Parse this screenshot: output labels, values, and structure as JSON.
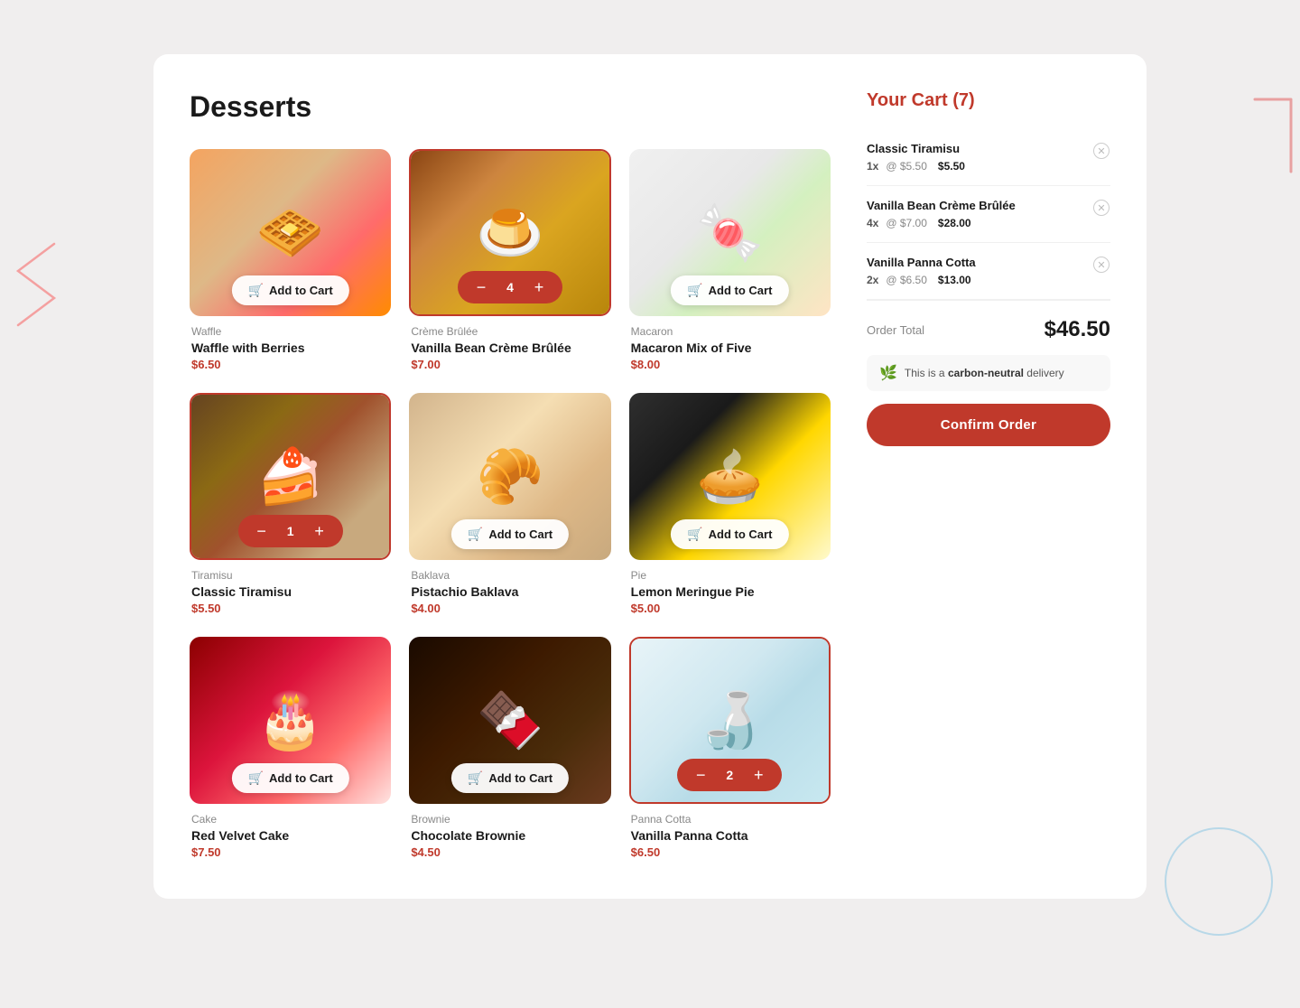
{
  "page": {
    "title": "Desserts",
    "background_color": "#f0eeee"
  },
  "products": [
    {
      "id": "waffle",
      "category": "Waffle",
      "name": "Waffle with Berries",
      "price": "$6.50",
      "image_class": "img-waffle",
      "emoji": "🧇",
      "has_quantity": false,
      "quantity": 0
    },
    {
      "id": "creme-brulee",
      "category": "Crème Brûlée",
      "name": "Vanilla Bean Crème Brûlée",
      "price": "$7.00",
      "image_class": "img-creme",
      "emoji": "🍮",
      "has_quantity": true,
      "quantity": 4,
      "selected": true
    },
    {
      "id": "macaron",
      "category": "Macaron",
      "name": "Macaron Mix of Five",
      "price": "$8.00",
      "image_class": "img-macaron",
      "emoji": "🍬",
      "has_quantity": false,
      "quantity": 0
    },
    {
      "id": "tiramisu",
      "category": "Tiramisu",
      "name": "Classic Tiramisu",
      "price": "$5.50",
      "image_class": "img-tiramisu",
      "emoji": "🍰",
      "has_quantity": true,
      "quantity": 1,
      "selected": true
    },
    {
      "id": "baklava",
      "category": "Baklava",
      "name": "Pistachio Baklava",
      "price": "$4.00",
      "image_class": "img-baklava",
      "emoji": "🥐",
      "has_quantity": false,
      "quantity": 0
    },
    {
      "id": "lemon-pie",
      "category": "Pie",
      "name": "Lemon Meringue Pie",
      "price": "$5.00",
      "image_class": "img-lemon-pie",
      "emoji": "🥧",
      "has_quantity": false,
      "quantity": 0
    },
    {
      "id": "red-velvet",
      "category": "Cake",
      "name": "Red Velvet Cake",
      "price": "$7.50",
      "image_class": "img-redvelvet",
      "emoji": "🎂",
      "has_quantity": false,
      "quantity": 0
    },
    {
      "id": "brownie",
      "category": "Brownie",
      "name": "Chocolate Brownie",
      "price": "$4.50",
      "image_class": "img-brownie",
      "emoji": "🍫",
      "has_quantity": false,
      "quantity": 0
    },
    {
      "id": "panna-cotta",
      "category": "Panna Cotta",
      "name": "Vanilla Panna Cotta",
      "price": "$6.50",
      "image_class": "img-panna",
      "emoji": "🍶",
      "has_quantity": true,
      "quantity": 2,
      "selected": true
    }
  ],
  "cart": {
    "title": "Your Cart (7)",
    "items": [
      {
        "name": "Classic Tiramisu",
        "qty": "1x",
        "unit_price": "$5.50",
        "total": "$5.50"
      },
      {
        "name": "Vanilla Bean Crème Brûlée",
        "qty": "4x",
        "unit_price": "$7.00",
        "total": "$28.00"
      },
      {
        "name": "Vanilla Panna Cotta",
        "qty": "2x",
        "unit_price": "$6.50",
        "total": "$13.00"
      }
    ],
    "order_total_label": "Order Total",
    "order_total_value": "$46.50",
    "carbon_neutral_text_prefix": "This is a ",
    "carbon_neutral_bold": "carbon-neutral",
    "carbon_neutral_text_suffix": " delivery",
    "confirm_button_label": "Confirm Order"
  },
  "add_to_cart_label": "Add to Cart",
  "at_symbol": "@"
}
